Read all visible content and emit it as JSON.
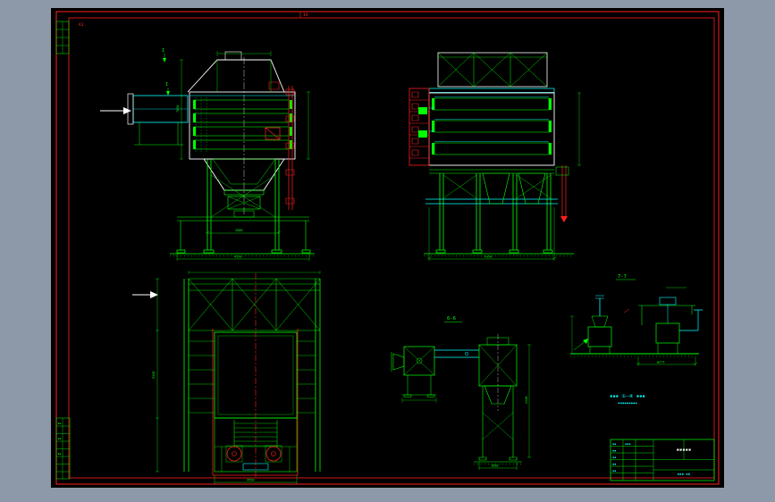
{
  "palette": {
    "bg": "#8d98a9",
    "sheet": "#000000",
    "frame_red": "#ff2020",
    "line_green": "#00ff00",
    "line_cyan": "#00ffff",
    "line_white": "#ffffff"
  },
  "frame": {
    "corner_code": "A1",
    "zone_mark": "1A"
  },
  "marks": {
    "section_i_top": "I",
    "section_i_mid": "I",
    "detail_fan": "6-6",
    "detail_nozzle": "7-7"
  },
  "dims": {
    "front_height": "7650",
    "front_width": "2000",
    "front_total": "4550",
    "side_width": "9350",
    "plan_height": "9350",
    "plan_width": "4550",
    "fan_width": "1600",
    "fan_height": "2240",
    "nozzle_width": "φ273"
  },
  "notes": {
    "line1": "▪▪▪ ①—④ ▪▪▪",
    "line2": "▪▪▪▪▪▪▪▪▪"
  },
  "titleblock": {
    "r1": "▪▪",
    "r2": "▪▪",
    "r3": "▪▪",
    "r4": "▪▪",
    "r5": "▪▪",
    "c2r1": "▪▪▪",
    "title": "▪▪▪▪▪",
    "sub": "▪▪▪ ▪▪"
  },
  "revtable": {
    "a": "▪▪",
    "b": "▪▪",
    "c": "▪▪"
  }
}
